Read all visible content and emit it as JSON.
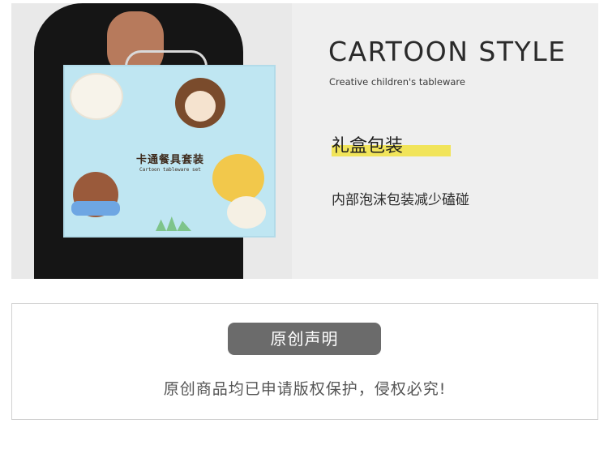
{
  "product": {
    "box_title": "卡通餐具套装",
    "box_subtitle": "Cartoon tableware set"
  },
  "hero": {
    "brand_title": "CARTOON STYLE",
    "tagline": "Creative children's tableware",
    "feature_heading": "礼盒包装",
    "feature_desc": "内部泡沫包装减少磕碰",
    "highlight_color": "#f1e45a"
  },
  "notice": {
    "badge": "原创声明",
    "text": "原创商品均已申请版权保护，侵权必究!"
  }
}
